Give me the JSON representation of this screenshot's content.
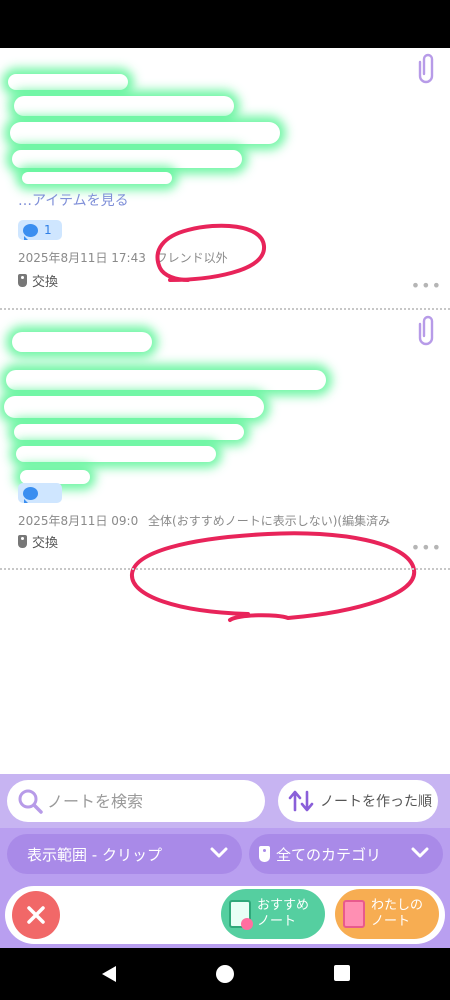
{
  "notes": [
    {
      "see_items": "…アイテムを見る",
      "comment_count": "1",
      "date": "2025年8月11日 17:43",
      "visibility": "フレンド以外",
      "tag": "交換"
    },
    {
      "date": "2025年8月11日 09:0",
      "visibility": "全体(おすすめノートに表示しない)(編集済み",
      "tag": "交換"
    }
  ],
  "icons": {
    "clip": "paperclip-icon",
    "comment": "speech-bubble-icon",
    "tag": "tag-icon",
    "more": "more-dots-icon",
    "search": "search-icon",
    "sort": "sort-arrows-icon",
    "chevron": "chevron-down-icon",
    "close": "close-icon"
  },
  "more_label": "•••",
  "search": {
    "placeholder": "ノートを検索"
  },
  "sort": {
    "label": "ノートを作った順"
  },
  "filters": {
    "scope": "表示範囲 - クリップ",
    "category": "全てのカテゴリ"
  },
  "bottom_nav": {
    "recommended_line1": "おすすめ",
    "recommended_line2": "ノート",
    "mine_line1": "わたしの",
    "mine_line2": "ノート"
  },
  "colors": {
    "panel_bg": "#c7b4f2",
    "pill_bg": "#a98ae8",
    "close_red": "#f16868",
    "recommended_green": "#55cfa0",
    "mine_orange": "#f7ad52",
    "annotation_red": "#e8245a",
    "redaction_glow": "#5af596"
  }
}
